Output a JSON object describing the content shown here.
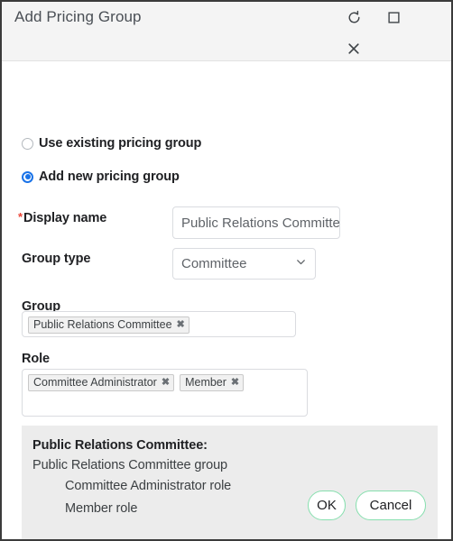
{
  "window": {
    "title": "Add Pricing Group",
    "controls": [
      {
        "name": "refresh-button",
        "icon": "refresh-icon"
      },
      {
        "name": "maximize-button",
        "icon": "maximize-icon"
      },
      {
        "name": "close-button",
        "icon": "close-icon"
      }
    ]
  },
  "form": {
    "mode_options": [
      {
        "label": "Use existing pricing group",
        "selected": false
      },
      {
        "label": "Add new pricing group",
        "selected": true
      }
    ],
    "display_name": {
      "label": "Display name",
      "required_marker": "*",
      "value": "Public Relations Committee",
      "placeholder": ""
    },
    "group_type": {
      "label": "Group type",
      "value": "Committee"
    },
    "group": {
      "label": "Group",
      "chips": [
        "Public Relations Committee"
      ]
    },
    "role": {
      "label": "Role",
      "chips": [
        "Committee Administrator",
        "Member"
      ]
    },
    "chip_remove_glyph": "✖"
  },
  "summary": {
    "title": "Public Relations Committee:",
    "lines": [
      {
        "text": "Public Relations Committee group",
        "indent": false
      },
      {
        "text": "Committee Administrator role",
        "indent": true
      },
      {
        "text": "Member role",
        "indent": true
      }
    ]
  },
  "footer": {
    "ok_label": "OK",
    "cancel_label": "Cancel"
  },
  "colors": {
    "accent_radio": "#1a73e8",
    "required_star": "#ea4335",
    "button_border": "#86dfae",
    "titlebar_bg": "#f4f4f4",
    "summary_bg": "#ececec",
    "dialog_border": "#3b3b3b"
  }
}
